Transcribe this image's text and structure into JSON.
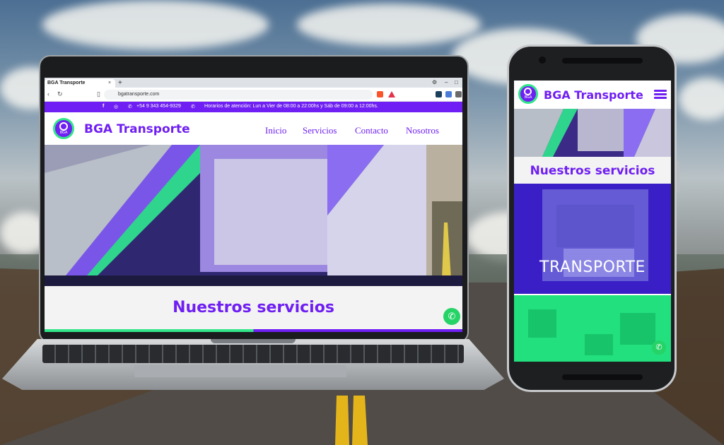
{
  "browser": {
    "tab_title": "BGA Transporte",
    "tab_close": "×",
    "tab_new": "+",
    "url": "bgatransporte.com"
  },
  "site": {
    "phone": "+54 9 343 454-9329",
    "hours": "Horarios de atención: Lun a Vier de 08:00 a 22:00hs y Sáb de 09:00 a 12:00hs.",
    "logo_text": "BGA",
    "brand": "BGA Transporte",
    "nav": [
      "Inicio",
      "Servicios",
      "Contacto",
      "Nosotros"
    ],
    "services_title": "Nuestros servicios"
  },
  "mobile": {
    "brand": "BGA Transporte",
    "services_title": "Nuestros servicios",
    "card_label": "TRANSPORTE"
  },
  "icons": {
    "facebook": "f",
    "instagram": "◎",
    "phone": "✆",
    "whatsapp": "✆"
  },
  "colors": {
    "brand_purple": "#6f1ff3",
    "brand_green": "#33e68a",
    "whatsapp_green": "#25d366"
  }
}
